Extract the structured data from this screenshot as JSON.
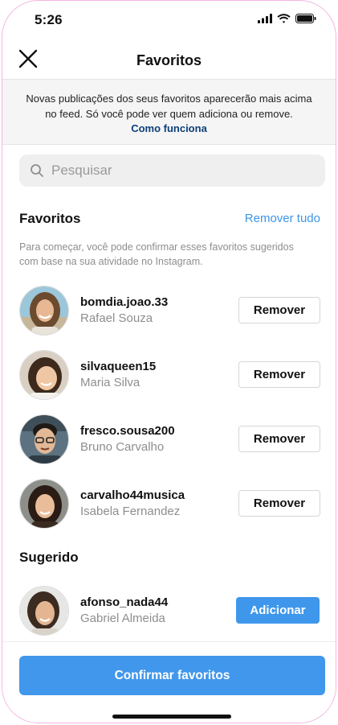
{
  "status_bar": {
    "time": "5:26"
  },
  "header": {
    "title": "Favoritos"
  },
  "notice": {
    "text": "Novas publicações dos seus favoritos aparecerão mais acima no feed. Só você pode ver quem adiciona ou remove.",
    "link": "Como funciona"
  },
  "search": {
    "placeholder": "Pesquisar"
  },
  "favorites": {
    "title": "Favoritos",
    "remove_all": "Remover tudo",
    "hint": "Para começar, você pode confirmar esses favoritos sugeridos com base na sua atividade no Instagram.",
    "items": [
      {
        "username": "bomdia.joao.33",
        "name": "Rafael Souza",
        "action": "Remover"
      },
      {
        "username": "silvaqueen15",
        "name": "Maria Silva",
        "action": "Remover"
      },
      {
        "username": "fresco.sousa200",
        "name": "Bruno Carvalho",
        "action": "Remover"
      },
      {
        "username": "carvalho44musica",
        "name": "Isabela Fernandez",
        "action": "Remover"
      }
    ]
  },
  "suggested": {
    "title": "Sugerido",
    "items": [
      {
        "username": "afonso_nada44",
        "name": "Gabriel Almeida",
        "action": "Adicionar"
      }
    ]
  },
  "footer": {
    "confirm_label": "Confirmar favoritos"
  },
  "colors": {
    "accent": "#3f97ec",
    "link_dark": "#0c3f7a",
    "link_blue": "#3d96e8",
    "muted": "#8e8e8e"
  }
}
